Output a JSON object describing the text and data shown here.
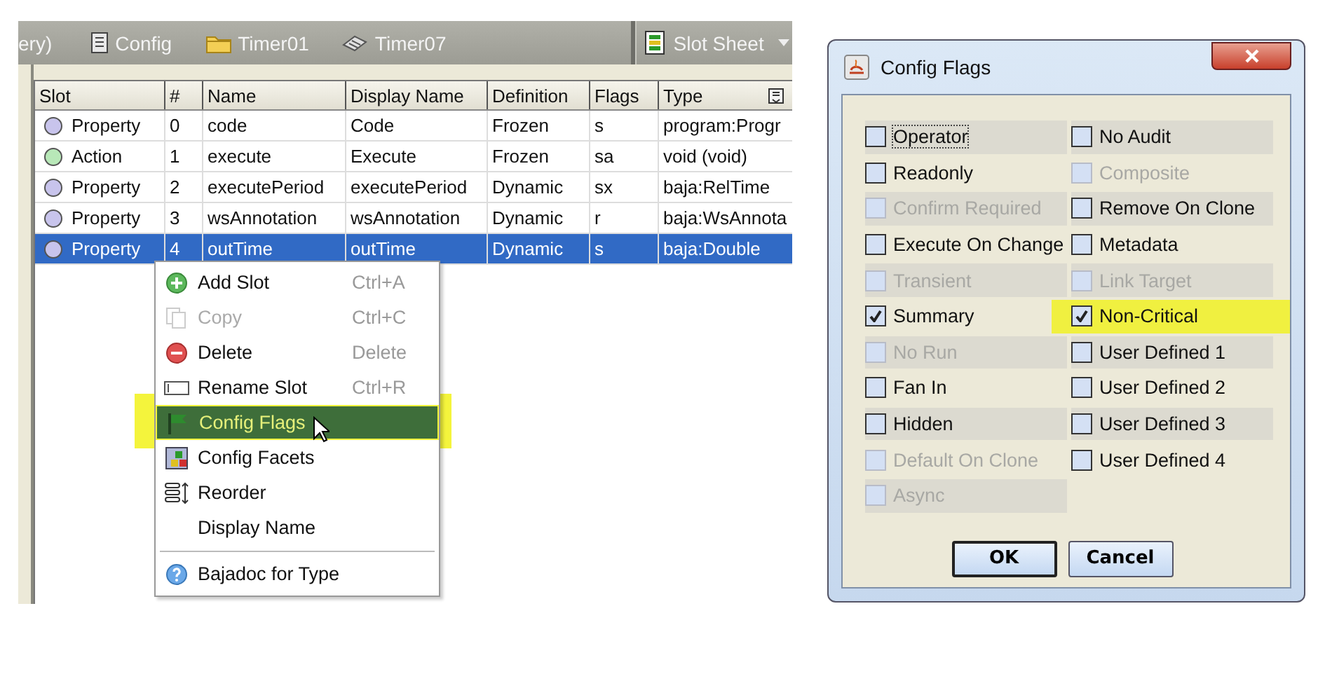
{
  "toolbar": {
    "crumbs": [
      {
        "kind": "text",
        "label": "ery)"
      },
      {
        "kind": "doc",
        "label": "Config"
      },
      {
        "kind": "folder",
        "label": "Timer01"
      },
      {
        "kind": "device",
        "label": "Timer07"
      }
    ],
    "view_selector": {
      "label": "Slot Sheet"
    }
  },
  "table": {
    "columns": [
      "Slot",
      "#",
      "Name",
      "Display Name",
      "Definition",
      "Flags",
      "Type"
    ],
    "rows": [
      {
        "kind": "property",
        "slot": "Property",
        "index": "0",
        "name": "code",
        "display_name": "Code",
        "definition": "Frozen",
        "flags": "s",
        "type": "program:Progr",
        "selected": false
      },
      {
        "kind": "action",
        "slot": "Action",
        "index": "1",
        "name": "execute",
        "display_name": "Execute",
        "definition": "Frozen",
        "flags": "sa",
        "type": "void (void)",
        "selected": false
      },
      {
        "kind": "property",
        "slot": "Property",
        "index": "2",
        "name": "executePeriod",
        "display_name": "executePeriod",
        "definition": "Dynamic",
        "flags": "sx",
        "type": "baja:RelTime",
        "selected": false
      },
      {
        "kind": "property",
        "slot": "Property",
        "index": "3",
        "name": "wsAnnotation",
        "display_name": "wsAnnotation",
        "definition": "Dynamic",
        "flags": "r",
        "type": "baja:WsAnnota",
        "selected": false
      },
      {
        "kind": "property",
        "slot": "Property",
        "index": "4",
        "name": "outTime",
        "display_name": "outTime",
        "definition": "Dynamic",
        "flags": "s",
        "type": "baja:Double",
        "selected": true
      }
    ]
  },
  "context_menu": {
    "items": [
      {
        "kind": "add",
        "label": "Add Slot",
        "shortcut": "Ctrl+A",
        "disabled": false,
        "selected": false,
        "highlighted": false
      },
      {
        "kind": "copy",
        "label": "Copy",
        "shortcut": "Ctrl+C",
        "disabled": true,
        "selected": false,
        "highlighted": false
      },
      {
        "kind": "delete",
        "label": "Delete",
        "shortcut": "Delete",
        "disabled": false,
        "selected": false,
        "highlighted": false
      },
      {
        "kind": "rename",
        "label": "Rename Slot",
        "shortcut": "Ctrl+R",
        "disabled": false,
        "selected": false,
        "highlighted": false
      },
      {
        "kind": "flag",
        "label": "Config Flags",
        "disabled": false,
        "selected": true,
        "highlighted": true
      },
      {
        "kind": "facets",
        "label": "Config Facets",
        "disabled": false,
        "selected": false,
        "highlighted": false
      },
      {
        "kind": "reorder",
        "label": "Reorder",
        "disabled": false,
        "selected": false,
        "highlighted": false
      },
      {
        "kind": "plain",
        "label": "Display Name",
        "disabled": false,
        "selected": false,
        "highlighted": false
      },
      {
        "kind": "separator"
      },
      {
        "kind": "help",
        "label": "Bajadoc for Type",
        "disabled": false,
        "selected": false,
        "highlighted": false
      }
    ]
  },
  "dialog": {
    "title": "Config Flags",
    "columns": [
      [
        {
          "label": "Operator",
          "checked": false,
          "disabled": false,
          "focused": true,
          "highlighted": false
        },
        {
          "label": "Readonly",
          "checked": false,
          "disabled": false,
          "focused": false,
          "highlighted": false
        },
        {
          "label": "Confirm Required",
          "checked": false,
          "disabled": true,
          "focused": false,
          "highlighted": false
        },
        {
          "label": "Execute On Change",
          "checked": false,
          "disabled": false,
          "focused": false,
          "highlighted": false
        },
        {
          "label": "Transient",
          "checked": false,
          "disabled": true,
          "focused": false,
          "highlighted": false
        },
        {
          "label": "Summary",
          "checked": true,
          "disabled": false,
          "focused": false,
          "highlighted": false
        },
        {
          "label": "No Run",
          "checked": false,
          "disabled": true,
          "focused": false,
          "highlighted": false
        },
        {
          "label": "Fan In",
          "checked": false,
          "disabled": false,
          "focused": false,
          "highlighted": false
        },
        {
          "label": "Hidden",
          "checked": false,
          "disabled": false,
          "focused": false,
          "highlighted": false
        },
        {
          "label": "Default On Clone",
          "checked": false,
          "disabled": true,
          "focused": false,
          "highlighted": false
        },
        {
          "label": "Async",
          "checked": false,
          "disabled": true,
          "focused": false,
          "highlighted": false
        }
      ],
      [
        {
          "label": "No Audit",
          "checked": false,
          "disabled": false,
          "focused": false,
          "highlighted": false
        },
        {
          "label": "Composite",
          "checked": false,
          "disabled": true,
          "focused": false,
          "highlighted": false
        },
        {
          "label": "Remove On Clone",
          "checked": false,
          "disabled": false,
          "focused": false,
          "highlighted": false
        },
        {
          "label": "Metadata",
          "checked": false,
          "disabled": false,
          "focused": false,
          "highlighted": false
        },
        {
          "label": "Link Target",
          "checked": false,
          "disabled": true,
          "focused": false,
          "highlighted": false
        },
        {
          "label": "Non-Critical",
          "checked": true,
          "disabled": false,
          "focused": false,
          "highlighted": true
        },
        {
          "label": "User Defined 1",
          "checked": false,
          "disabled": false,
          "focused": false,
          "highlighted": false
        },
        {
          "label": "User Defined 2",
          "checked": false,
          "disabled": false,
          "focused": false,
          "highlighted": false
        },
        {
          "label": "User Defined 3",
          "checked": false,
          "disabled": false,
          "focused": false,
          "highlighted": false
        },
        {
          "label": "User Defined 4",
          "checked": false,
          "disabled": false,
          "focused": false,
          "highlighted": false
        }
      ]
    ],
    "buttons": [
      {
        "label": "OK",
        "default": true
      },
      {
        "label": "Cancel",
        "default": false
      }
    ]
  }
}
